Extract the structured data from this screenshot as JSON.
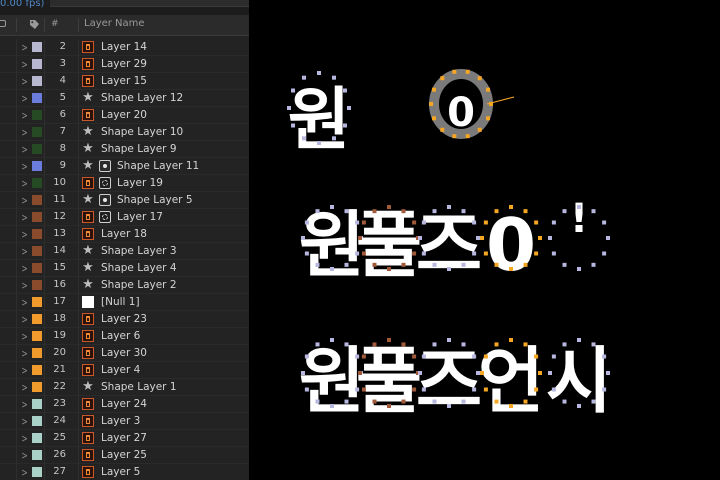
{
  "top_bar": {
    "fps_text": "0.00 fps)"
  },
  "header": {
    "num_label": "#",
    "name_label": "Layer Name"
  },
  "layers": [
    {
      "num": "2",
      "name": "Layer 14",
      "type": "ai",
      "color": "#b7b7cf"
    },
    {
      "num": "3",
      "name": "Layer 29",
      "type": "ai",
      "color": "#b7b7cf"
    },
    {
      "num": "4",
      "name": "Layer 15",
      "type": "ai",
      "color": "#b7b7cf"
    },
    {
      "num": "5",
      "name": "Shape Layer 12",
      "type": "shape",
      "color": "#6a7ddc"
    },
    {
      "num": "6",
      "name": "Layer 20",
      "type": "ai",
      "color": "#254a24"
    },
    {
      "num": "7",
      "name": "Shape Layer 10",
      "type": "shape",
      "color": "#254a24"
    },
    {
      "num": "8",
      "name": "Shape Layer 9",
      "type": "shape",
      "color": "#254a24"
    },
    {
      "num": "9",
      "name": "Shape Layer 11",
      "type": "shape",
      "sub": "circle",
      "color": "#6a7ddc"
    },
    {
      "num": "10",
      "name": "Layer 19",
      "type": "ai",
      "sub": "track",
      "color": "#254a24"
    },
    {
      "num": "11",
      "name": "Shape Layer 5",
      "type": "shape",
      "sub": "circle",
      "color": "#8a4a2c"
    },
    {
      "num": "12",
      "name": "Layer 17",
      "type": "ai",
      "sub": "track",
      "color": "#8a4a2c"
    },
    {
      "num": "13",
      "name": "Layer 18",
      "type": "ai",
      "color": "#8a4a2c"
    },
    {
      "num": "14",
      "name": "Shape Layer 3",
      "type": "shape",
      "color": "#8a4a2c"
    },
    {
      "num": "15",
      "name": "Shape Layer 4",
      "type": "shape",
      "color": "#8a4a2c"
    },
    {
      "num": "16",
      "name": "Shape Layer 2",
      "type": "shape",
      "color": "#8a4a2c"
    },
    {
      "num": "17",
      "name": "[Null 1]",
      "type": "null",
      "color": "#f19b2c"
    },
    {
      "num": "18",
      "name": "Layer 23",
      "type": "ai",
      "color": "#f19b2c"
    },
    {
      "num": "19",
      "name": "Layer 6",
      "type": "ai",
      "color": "#f19b2c"
    },
    {
      "num": "20",
      "name": "Layer 30",
      "type": "ai",
      "color": "#f19b2c"
    },
    {
      "num": "21",
      "name": "Layer 4",
      "type": "ai",
      "color": "#f19b2c"
    },
    {
      "num": "22",
      "name": "Shape Layer 1",
      "type": "shape",
      "color": "#f19b2c"
    },
    {
      "num": "23",
      "name": "Layer 24",
      "type": "ai",
      "color": "#a9d1c8"
    },
    {
      "num": "24",
      "name": "Layer 3",
      "type": "ai",
      "color": "#a9d1c8"
    },
    {
      "num": "25",
      "name": "Layer 27",
      "type": "ai",
      "color": "#a9d1c8"
    },
    {
      "num": "26",
      "name": "Layer 25",
      "type": "ai",
      "color": "#a9d1c8"
    },
    {
      "num": "27",
      "name": "Layer 5",
      "type": "ai",
      "color": "#a9d1c8"
    }
  ],
  "composition": {
    "row1": [
      "원",
      "0"
    ],
    "row2": [
      "원",
      "풀",
      "즈",
      "0",
      "!"
    ],
    "row3": [
      "원",
      "풀",
      "즈",
      "언",
      "시"
    ]
  },
  "colors": {
    "panel_bg": "#232323",
    "text_fill": "#ffffff",
    "handle_orange": "#f5a623",
    "handle_lavender": "#b7b7df",
    "handle_brown": "#a05a3a",
    "selected_ring": "#7a7a7a"
  }
}
